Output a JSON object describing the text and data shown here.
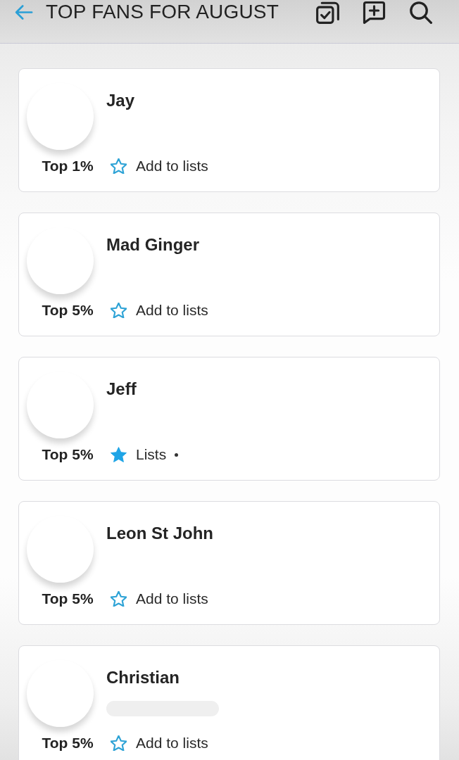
{
  "header": {
    "title": "TOP FANS FOR AUGUST"
  },
  "fans": [
    {
      "name": "Jay",
      "rank": "Top 1%",
      "list_label": "Add to lists",
      "listed": false,
      "subtitle_loading": false
    },
    {
      "name": "Mad Ginger",
      "rank": "Top 5%",
      "list_label": "Add to lists",
      "listed": false,
      "subtitle_loading": false
    },
    {
      "name": "Jeff",
      "rank": "Top 5%",
      "list_label": "Lists",
      "listed": true,
      "subtitle_loading": false
    },
    {
      "name": "Leon St John",
      "rank": "Top 5%",
      "list_label": "Add to lists",
      "listed": false,
      "subtitle_loading": false
    },
    {
      "name": "Christian",
      "rank": "Top 5%",
      "list_label": "Add to lists",
      "listed": false,
      "subtitle_loading": true
    }
  ]
}
